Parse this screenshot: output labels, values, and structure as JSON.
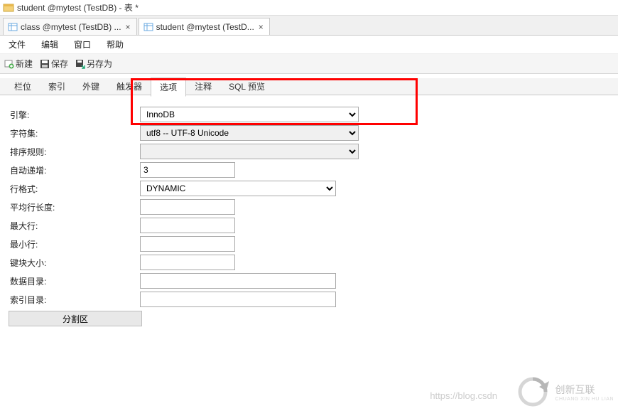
{
  "titlebar": {
    "title": "student @mytest (TestDB) - 表 *"
  },
  "doc_tabs": [
    {
      "label": "class @mytest (TestDB) ...",
      "active": false
    },
    {
      "label": "student @mytest (TestD...",
      "active": true
    }
  ],
  "menu": {
    "file": "文件",
    "edit": "编辑",
    "window": "窗口",
    "help": "帮助"
  },
  "toolbar": {
    "new": "新建",
    "save": "保存",
    "saveas": "另存为"
  },
  "subtabs": {
    "fields": "栏位",
    "indexes": "索引",
    "fks": "外键",
    "triggers": "触发器",
    "options": "选项",
    "comment": "注释",
    "sql": "SQL 预览"
  },
  "form": {
    "engine_label": "引擎:",
    "engine_value": "InnoDB",
    "charset_label": "字符集:",
    "charset_value": "utf8 -- UTF-8 Unicode",
    "collation_label": "排序规则:",
    "collation_value": "",
    "autoinc_label": "自动递增:",
    "autoinc_value": "3",
    "rowformat_label": "行格式:",
    "rowformat_value": "DYNAMIC",
    "avgrow_label": "平均行长度:",
    "avgrow_value": "",
    "maxrow_label": "最大行:",
    "maxrow_value": "",
    "minrow_label": "最小行:",
    "minrow_value": "",
    "keyblock_label": "键块大小:",
    "keyblock_value": "",
    "datadir_label": "数据目录:",
    "datadir_value": "",
    "indexdir_label": "索引目录:",
    "indexdir_value": "",
    "partition_btn": "分割区"
  },
  "watermark": {
    "url_text": "https://blog.csdn",
    "brand_top": "创新互联",
    "brand_bottom": "CHUANG XIN HU LIAN"
  }
}
